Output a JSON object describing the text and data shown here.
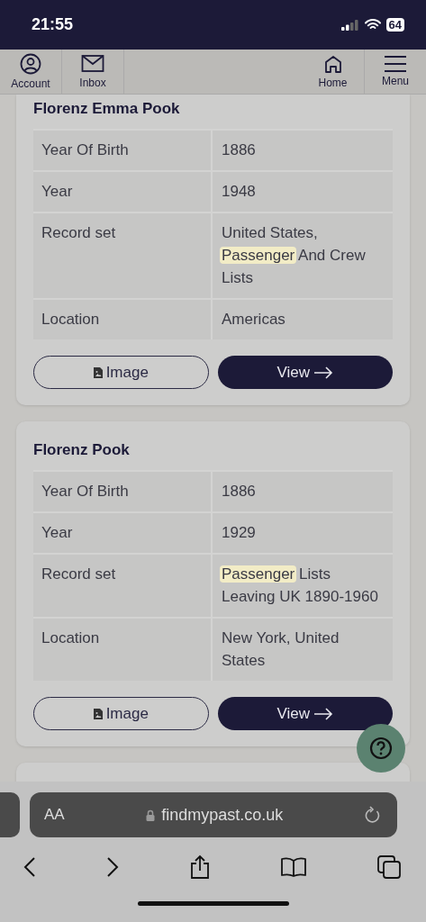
{
  "status_bar": {
    "time": "21:55",
    "battery": "64"
  },
  "nav": {
    "left": [
      {
        "label": "Account"
      },
      {
        "label": "Inbox"
      }
    ],
    "right": [
      {
        "label": "Home"
      },
      {
        "label": "Menu"
      }
    ]
  },
  "records": [
    {
      "name": "Florenz Emma Pook",
      "fields": [
        {
          "label": "Year Of Birth",
          "parts": [
            {
              "text": "1886",
              "highlighted": false
            }
          ]
        },
        {
          "label": "Year",
          "parts": [
            {
              "text": "1948",
              "highlighted": false
            }
          ]
        },
        {
          "label": "Record set",
          "parts": [
            {
              "text": "United States, ",
              "highlighted": false
            },
            {
              "text": "Passenger",
              "highlighted": true
            },
            {
              "text": " And Crew Lists",
              "highlighted": false
            }
          ]
        },
        {
          "label": "Location",
          "parts": [
            {
              "text": "Americas",
              "highlighted": false
            }
          ]
        }
      ],
      "image_button": "Image",
      "view_button": "View"
    },
    {
      "name": "Florenz Pook",
      "fields": [
        {
          "label": "Year Of Birth",
          "parts": [
            {
              "text": "1886",
              "highlighted": false
            }
          ]
        },
        {
          "label": "Year",
          "parts": [
            {
              "text": "1929",
              "highlighted": false
            }
          ]
        },
        {
          "label": "Record set",
          "parts": [
            {
              "text": "Passenger",
              "highlighted": true
            },
            {
              "text": " Lists Leaving UK 1890-1960",
              "highlighted": false
            }
          ]
        },
        {
          "label": "Location",
          "parts": [
            {
              "text": "New York, United States",
              "highlighted": false
            }
          ]
        }
      ],
      "image_button": "Image",
      "view_button": "View"
    }
  ],
  "browser": {
    "text_size": "AA",
    "url": "findmypast.co.uk"
  }
}
